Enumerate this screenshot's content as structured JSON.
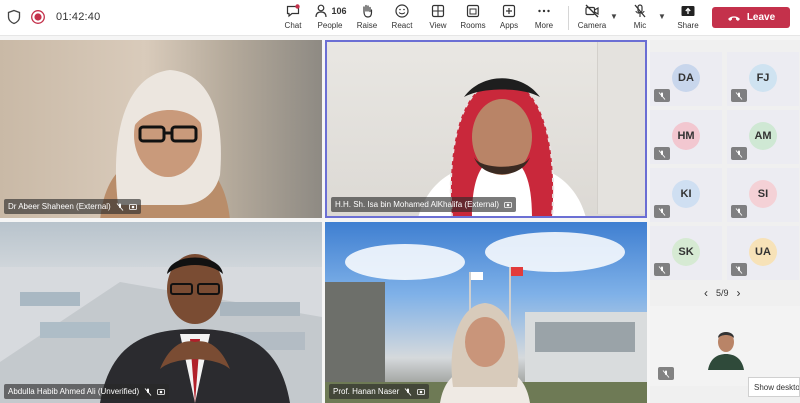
{
  "meeting": {
    "timer": "01:42:40"
  },
  "toolbar": {
    "chat": "Chat",
    "people": "People",
    "people_count": "106",
    "raise": "Raise",
    "react": "React",
    "view": "View",
    "rooms": "Rooms",
    "apps": "Apps",
    "more": "More",
    "camera": "Camera",
    "mic": "Mic",
    "share": "Share",
    "leave": "Leave"
  },
  "tiles": [
    {
      "name": "Dr Abeer Shaheen (External)"
    },
    {
      "name": "H.H. Sh. Isa bin Mohamed AlKhalifa (External)"
    },
    {
      "name": "Abdulla Habib Ahmed Ali (Unverified)"
    },
    {
      "name": "Prof. Hanan Naser"
    }
  ],
  "participants": [
    {
      "initials": "DA",
      "color": "#c8d6ec"
    },
    {
      "initials": "FJ",
      "color": "#cfe3f1"
    },
    {
      "initials": "HM",
      "color": "#f2c7d0"
    },
    {
      "initials": "AM",
      "color": "#cfe8d4"
    },
    {
      "initials": "KI",
      "color": "#cfdff2"
    },
    {
      "initials": "SI",
      "color": "#f4d1d6"
    },
    {
      "initials": "SK",
      "color": "#d6ead3"
    },
    {
      "initials": "UA",
      "color": "#f7e2b8"
    }
  ],
  "pagination": {
    "label": "5/9"
  },
  "tooltip": {
    "show_desktop": "Show desktop"
  },
  "colors": {
    "leave": "#c4314b",
    "active_speaker_border": "#6b6fd4"
  }
}
